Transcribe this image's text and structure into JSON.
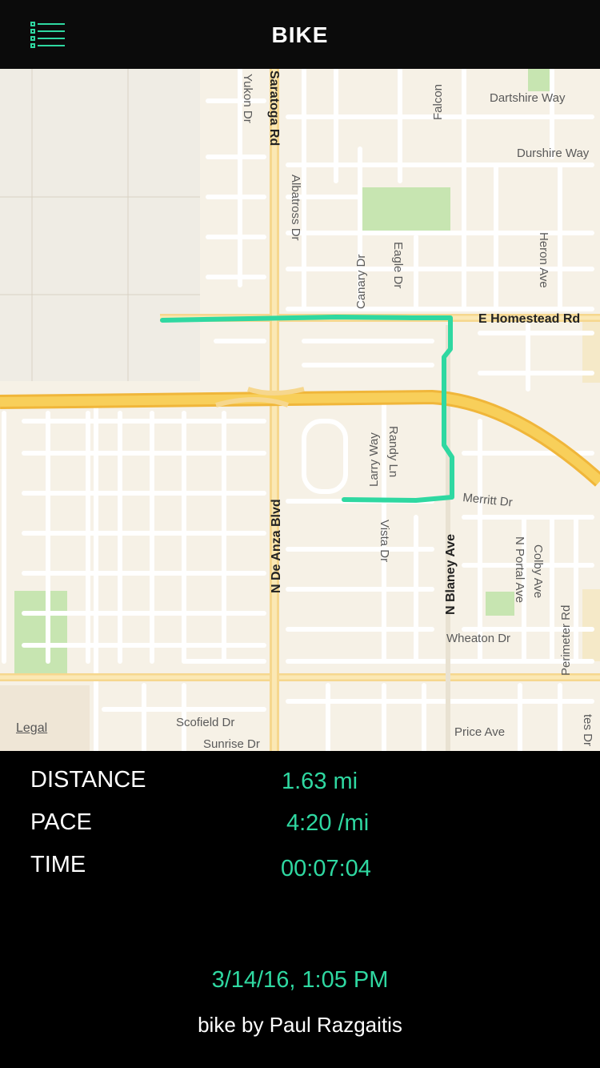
{
  "header": {
    "title": "BIKE",
    "menu_icon": "list-menu-icon",
    "accent_color": "#2fd8a1"
  },
  "map": {
    "route_color": "#2fd8a1",
    "legal_label": "Legal",
    "streets": {
      "saratoga": "Saratoga Rd",
      "yukon": "Yukon Dr",
      "albatross": "Albatross Dr",
      "falcon": "Falcon",
      "dartshire": "Dartshire Way",
      "durshire": "Durshire Way",
      "canary": "Canary Dr",
      "eagle": "Eagle Dr",
      "heron": "Heron Ave",
      "homestead": "E Homestead Rd",
      "larry": "Larry Way",
      "randy": "Randy Ln",
      "merritt": "Merritt Dr",
      "de_anza": "N De Anza Blvd",
      "vista": "Vista Dr",
      "blaney": "N Blaney Ave",
      "portal": "N Portal Ave",
      "colby": "Colby Ave",
      "perimeter": "Perimeter Rd",
      "wheaton": "Wheaton Dr",
      "scofield": "Scofield Dr",
      "sunrise": "Sunrise Dr",
      "price": "Price Ave",
      "estes": "tes Dr"
    }
  },
  "stats": {
    "distance_label": "DISTANCE",
    "distance_value": "1.63 mi",
    "pace_label": "PACE",
    "pace_value": "4:20 /mi",
    "time_label": "TIME",
    "time_value": "00:07:04"
  },
  "footer": {
    "date": "3/14/16, 1:05 PM",
    "credit": "bike by Paul Razgaitis"
  }
}
